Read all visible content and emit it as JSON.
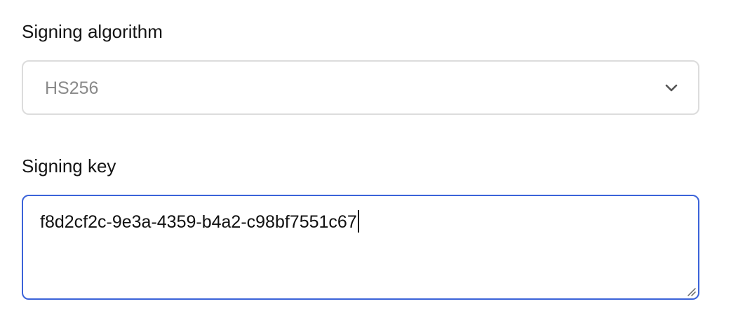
{
  "form": {
    "algorithm_label": "Signing algorithm",
    "algorithm_value": "HS256",
    "key_label": "Signing key",
    "key_value": "f8d2cf2c-9e3a-4359-b4a2-c98bf7551c67"
  },
  "icons": {
    "dropdown": "chevron-down-icon",
    "resize": "resize-handle-icon"
  },
  "colors": {
    "focus_border": "#3b63d9",
    "input_border": "#dcdcdc",
    "placeholder_text": "#8a8a8a"
  }
}
